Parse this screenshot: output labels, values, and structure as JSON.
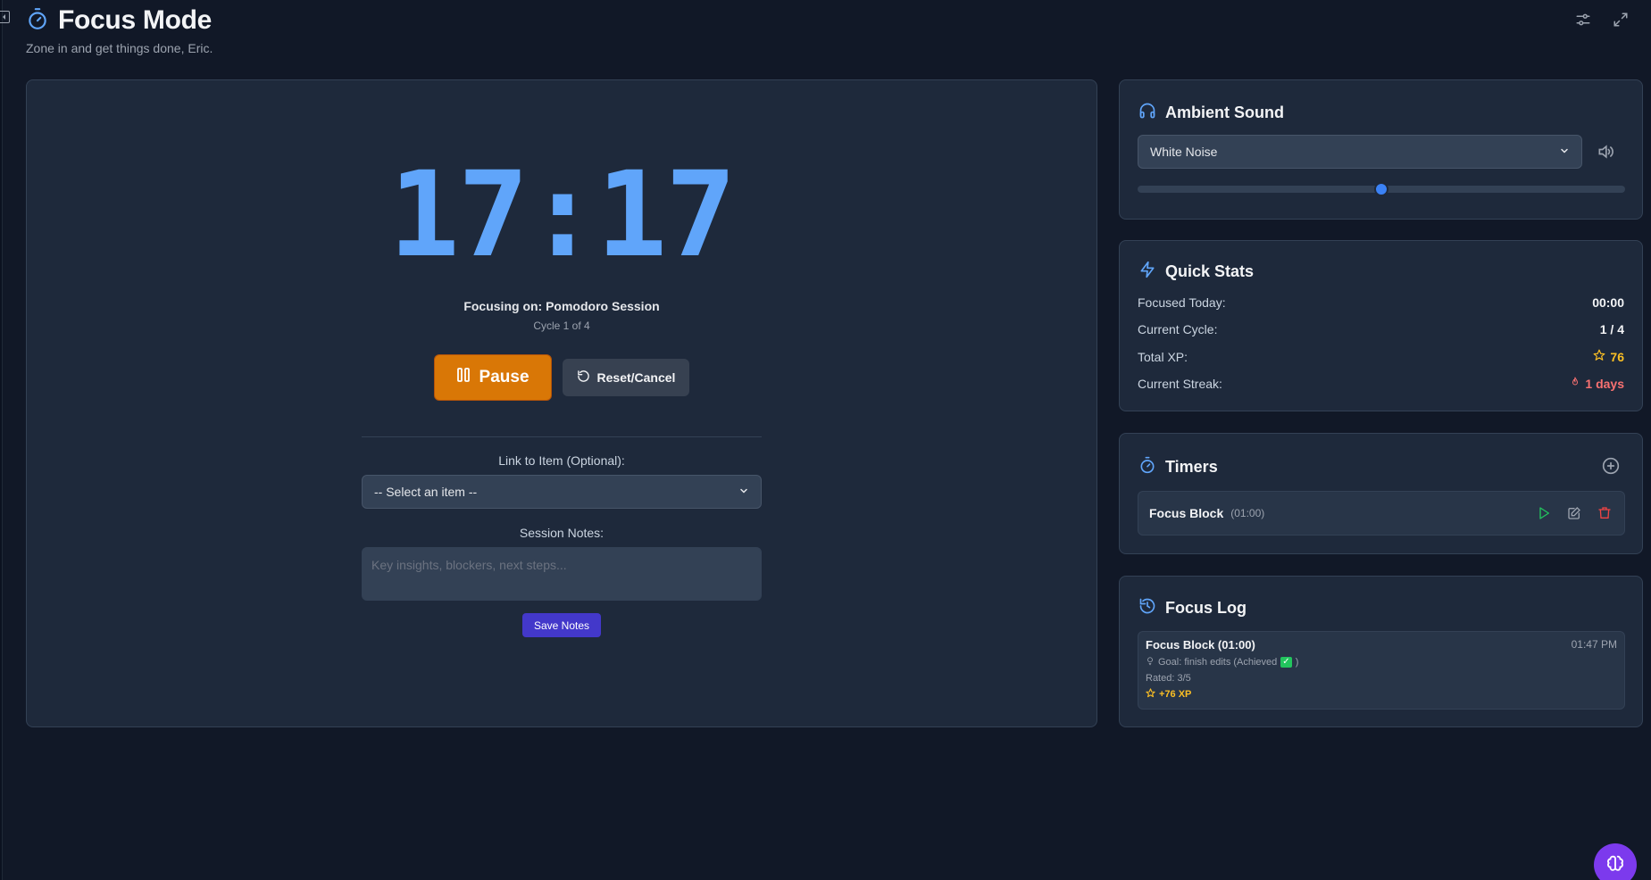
{
  "header": {
    "title": "Focus Mode",
    "subtitle": "Zone in and get things done, Eric."
  },
  "timer": {
    "time": "17:17",
    "focusing_on": "Focusing on: Pomodoro Session",
    "cycle": "Cycle 1 of 4",
    "pause_label": "Pause",
    "reset_label": "Reset/Cancel",
    "link_label": "Link to Item (Optional):",
    "select_item_value": "-- Select an item --",
    "notes_label": "Session Notes:",
    "notes_placeholder": "Key insights, blockers, next steps...",
    "save_label": "Save Notes"
  },
  "ambient": {
    "title": "Ambient Sound",
    "selected": "White Noise",
    "volume": 0.5
  },
  "stats": {
    "title": "Quick Stats",
    "rows": [
      {
        "label": "Focused Today:",
        "value": "00:00"
      },
      {
        "label": "Current Cycle:",
        "value": "1 / 4"
      },
      {
        "label": "Total XP:",
        "value": "76"
      },
      {
        "label": "Current Streak:",
        "value": "1 days"
      }
    ]
  },
  "timers": {
    "title": "Timers",
    "items": [
      {
        "name": "Focus Block",
        "duration": "(01:00)"
      }
    ]
  },
  "log": {
    "title": "Focus Log",
    "entries": [
      {
        "title": "Focus Block (01:00)",
        "time": "01:47 PM",
        "goal": "Goal: finish edits (Achieved",
        "rating": "Rated: 3/5",
        "xp": "+76 XP"
      }
    ]
  },
  "colors": {
    "accent": "#60a5fa",
    "pause": "#d97706",
    "save": "#4338ca",
    "xp": "#fbbf24",
    "streak": "#f87171",
    "play": "#22c55e",
    "delete": "#ef4444"
  }
}
